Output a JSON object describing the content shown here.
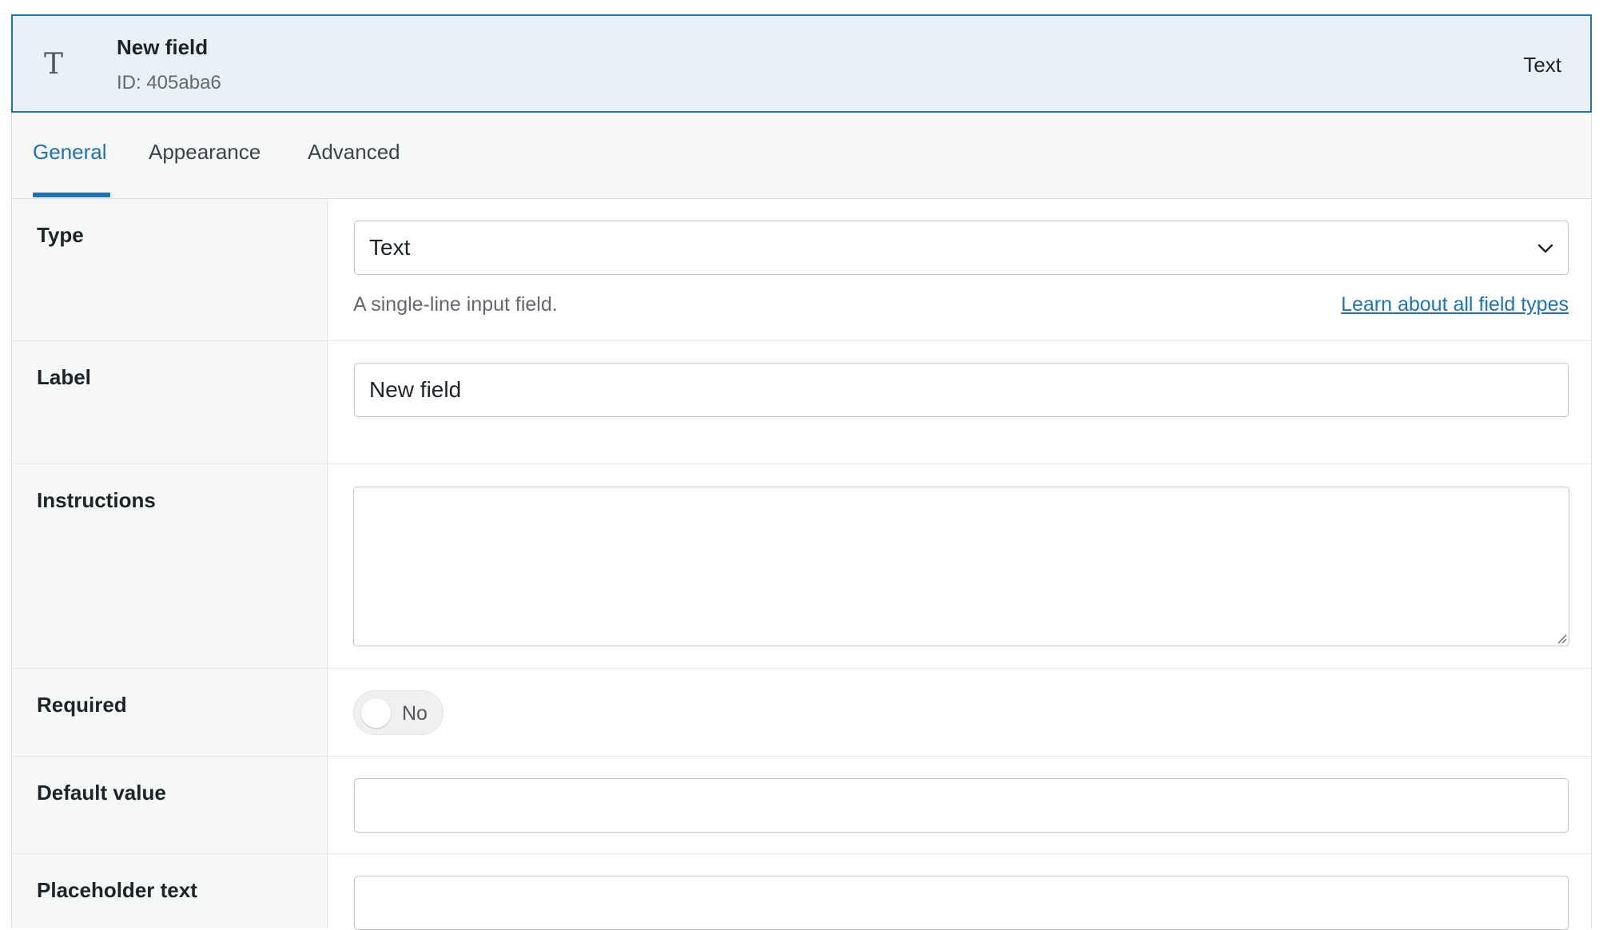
{
  "header": {
    "icon": "text-type-icon",
    "icon_glyph": "T",
    "title": "New field",
    "id_text": "ID: 405aba6",
    "type_label": "Text"
  },
  "tabs": [
    {
      "label": "General",
      "active": true
    },
    {
      "label": "Appearance",
      "active": false
    },
    {
      "label": "Advanced",
      "active": false
    }
  ],
  "fields": {
    "type": {
      "label": "Type",
      "value": "Text",
      "help": "A single-line input field.",
      "link": "Learn about all field types"
    },
    "label": {
      "label": "Label",
      "value": "New field"
    },
    "instructions": {
      "label": "Instructions",
      "value": ""
    },
    "required": {
      "label": "Required",
      "state": "No"
    },
    "default_value": {
      "label": "Default value",
      "value": ""
    },
    "placeholder": {
      "label": "Placeholder text",
      "value": ""
    }
  },
  "colors": {
    "accent": "#2271b1",
    "header_bg": "#e9f0f7",
    "label_bg": "#f6f7f7"
  }
}
